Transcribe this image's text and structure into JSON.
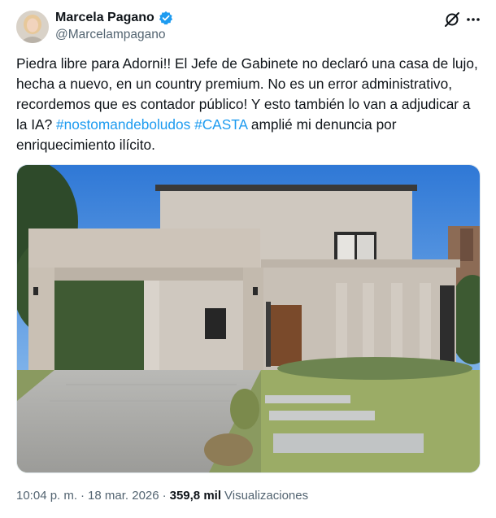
{
  "author": {
    "display_name": "Marcela Pagano",
    "handle": "@Marcelampagano",
    "verified": true
  },
  "post": {
    "text_1": "Piedra libre para Adorni!! El Jefe de Gabinete no declaró una casa de lujo, hecha a nuevo, en un country premium. No es un error administrativo, recordemos que es contador público! Y esto también lo van a adjudicar a la IA? ",
    "hashtag_1": "#nostomandeboludos",
    "hashtag_2": "#CASTA",
    "text_2": " amplié mi denuncia por enriquecimiento ilícito."
  },
  "meta": {
    "time": "10:04 p. m.",
    "sep_1": "·",
    "date": "18 mar. 2026",
    "sep_2": "·",
    "views_count": "359,8 mil",
    "views_label": "Visualizaciones"
  },
  "colors": {
    "accent": "#1d9bf0",
    "text_primary": "#0f1419",
    "text_secondary": "#536471"
  },
  "icons": {
    "verified": "verified-badge-icon",
    "grok": "grok-icon",
    "more": "more-horizontal-icon"
  }
}
